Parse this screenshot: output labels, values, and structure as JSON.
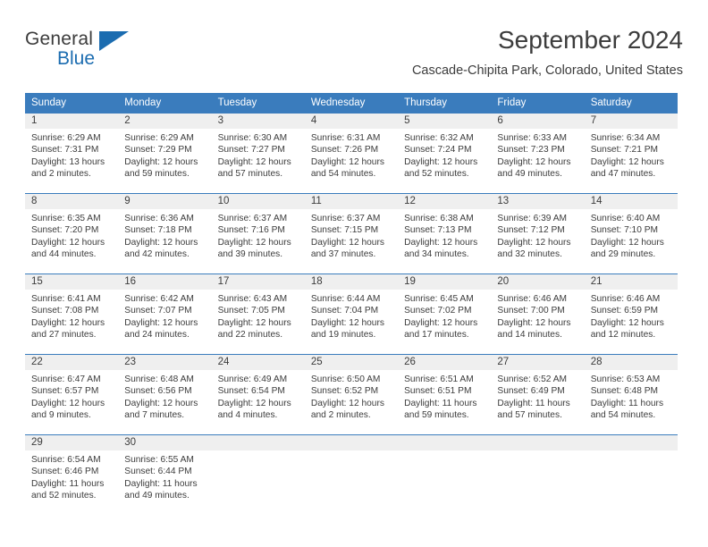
{
  "brand": {
    "name_part1": "General",
    "name_part2": "Blue",
    "flag_icon": "triangle-flag-icon",
    "color_blue": "#1b6cb0",
    "color_dark": "#3c3c3c"
  },
  "header": {
    "month_title": "September 2024",
    "location": "Cascade-Chipita Park, Colorado, United States"
  },
  "theme": {
    "header_blue": "#3a7cbd",
    "daynum_band": "#efefef",
    "text": "#3c3c3c"
  },
  "weekday_headers": [
    "Sunday",
    "Monday",
    "Tuesday",
    "Wednesday",
    "Thursday",
    "Friday",
    "Saturday"
  ],
  "labels": {
    "sunrise_prefix": "Sunrise:",
    "sunset_prefix": "Sunset:",
    "daylight_prefix": "Daylight:"
  },
  "weeks": [
    [
      {
        "day": "1",
        "sunrise": "Sunrise: 6:29 AM",
        "sunset": "Sunset: 7:31 PM",
        "daylight_line1": "Daylight: 13 hours",
        "daylight_line2": "and 2 minutes."
      },
      {
        "day": "2",
        "sunrise": "Sunrise: 6:29 AM",
        "sunset": "Sunset: 7:29 PM",
        "daylight_line1": "Daylight: 12 hours",
        "daylight_line2": "and 59 minutes."
      },
      {
        "day": "3",
        "sunrise": "Sunrise: 6:30 AM",
        "sunset": "Sunset: 7:27 PM",
        "daylight_line1": "Daylight: 12 hours",
        "daylight_line2": "and 57 minutes."
      },
      {
        "day": "4",
        "sunrise": "Sunrise: 6:31 AM",
        "sunset": "Sunset: 7:26 PM",
        "daylight_line1": "Daylight: 12 hours",
        "daylight_line2": "and 54 minutes."
      },
      {
        "day": "5",
        "sunrise": "Sunrise: 6:32 AM",
        "sunset": "Sunset: 7:24 PM",
        "daylight_line1": "Daylight: 12 hours",
        "daylight_line2": "and 52 minutes."
      },
      {
        "day": "6",
        "sunrise": "Sunrise: 6:33 AM",
        "sunset": "Sunset: 7:23 PM",
        "daylight_line1": "Daylight: 12 hours",
        "daylight_line2": "and 49 minutes."
      },
      {
        "day": "7",
        "sunrise": "Sunrise: 6:34 AM",
        "sunset": "Sunset: 7:21 PM",
        "daylight_line1": "Daylight: 12 hours",
        "daylight_line2": "and 47 minutes."
      }
    ],
    [
      {
        "day": "8",
        "sunrise": "Sunrise: 6:35 AM",
        "sunset": "Sunset: 7:20 PM",
        "daylight_line1": "Daylight: 12 hours",
        "daylight_line2": "and 44 minutes."
      },
      {
        "day": "9",
        "sunrise": "Sunrise: 6:36 AM",
        "sunset": "Sunset: 7:18 PM",
        "daylight_line1": "Daylight: 12 hours",
        "daylight_line2": "and 42 minutes."
      },
      {
        "day": "10",
        "sunrise": "Sunrise: 6:37 AM",
        "sunset": "Sunset: 7:16 PM",
        "daylight_line1": "Daylight: 12 hours",
        "daylight_line2": "and 39 minutes."
      },
      {
        "day": "11",
        "sunrise": "Sunrise: 6:37 AM",
        "sunset": "Sunset: 7:15 PM",
        "daylight_line1": "Daylight: 12 hours",
        "daylight_line2": "and 37 minutes."
      },
      {
        "day": "12",
        "sunrise": "Sunrise: 6:38 AM",
        "sunset": "Sunset: 7:13 PM",
        "daylight_line1": "Daylight: 12 hours",
        "daylight_line2": "and 34 minutes."
      },
      {
        "day": "13",
        "sunrise": "Sunrise: 6:39 AM",
        "sunset": "Sunset: 7:12 PM",
        "daylight_line1": "Daylight: 12 hours",
        "daylight_line2": "and 32 minutes."
      },
      {
        "day": "14",
        "sunrise": "Sunrise: 6:40 AM",
        "sunset": "Sunset: 7:10 PM",
        "daylight_line1": "Daylight: 12 hours",
        "daylight_line2": "and 29 minutes."
      }
    ],
    [
      {
        "day": "15",
        "sunrise": "Sunrise: 6:41 AM",
        "sunset": "Sunset: 7:08 PM",
        "daylight_line1": "Daylight: 12 hours",
        "daylight_line2": "and 27 minutes."
      },
      {
        "day": "16",
        "sunrise": "Sunrise: 6:42 AM",
        "sunset": "Sunset: 7:07 PM",
        "daylight_line1": "Daylight: 12 hours",
        "daylight_line2": "and 24 minutes."
      },
      {
        "day": "17",
        "sunrise": "Sunrise: 6:43 AM",
        "sunset": "Sunset: 7:05 PM",
        "daylight_line1": "Daylight: 12 hours",
        "daylight_line2": "and 22 minutes."
      },
      {
        "day": "18",
        "sunrise": "Sunrise: 6:44 AM",
        "sunset": "Sunset: 7:04 PM",
        "daylight_line1": "Daylight: 12 hours",
        "daylight_line2": "and 19 minutes."
      },
      {
        "day": "19",
        "sunrise": "Sunrise: 6:45 AM",
        "sunset": "Sunset: 7:02 PM",
        "daylight_line1": "Daylight: 12 hours",
        "daylight_line2": "and 17 minutes."
      },
      {
        "day": "20",
        "sunrise": "Sunrise: 6:46 AM",
        "sunset": "Sunset: 7:00 PM",
        "daylight_line1": "Daylight: 12 hours",
        "daylight_line2": "and 14 minutes."
      },
      {
        "day": "21",
        "sunrise": "Sunrise: 6:46 AM",
        "sunset": "Sunset: 6:59 PM",
        "daylight_line1": "Daylight: 12 hours",
        "daylight_line2": "and 12 minutes."
      }
    ],
    [
      {
        "day": "22",
        "sunrise": "Sunrise: 6:47 AM",
        "sunset": "Sunset: 6:57 PM",
        "daylight_line1": "Daylight: 12 hours",
        "daylight_line2": "and 9 minutes."
      },
      {
        "day": "23",
        "sunrise": "Sunrise: 6:48 AM",
        "sunset": "Sunset: 6:56 PM",
        "daylight_line1": "Daylight: 12 hours",
        "daylight_line2": "and 7 minutes."
      },
      {
        "day": "24",
        "sunrise": "Sunrise: 6:49 AM",
        "sunset": "Sunset: 6:54 PM",
        "daylight_line1": "Daylight: 12 hours",
        "daylight_line2": "and 4 minutes."
      },
      {
        "day": "25",
        "sunrise": "Sunrise: 6:50 AM",
        "sunset": "Sunset: 6:52 PM",
        "daylight_line1": "Daylight: 12 hours",
        "daylight_line2": "and 2 minutes."
      },
      {
        "day": "26",
        "sunrise": "Sunrise: 6:51 AM",
        "sunset": "Sunset: 6:51 PM",
        "daylight_line1": "Daylight: 11 hours",
        "daylight_line2": "and 59 minutes."
      },
      {
        "day": "27",
        "sunrise": "Sunrise: 6:52 AM",
        "sunset": "Sunset: 6:49 PM",
        "daylight_line1": "Daylight: 11 hours",
        "daylight_line2": "and 57 minutes."
      },
      {
        "day": "28",
        "sunrise": "Sunrise: 6:53 AM",
        "sunset": "Sunset: 6:48 PM",
        "daylight_line1": "Daylight: 11 hours",
        "daylight_line2": "and 54 minutes."
      }
    ],
    [
      {
        "day": "29",
        "sunrise": "Sunrise: 6:54 AM",
        "sunset": "Sunset: 6:46 PM",
        "daylight_line1": "Daylight: 11 hours",
        "daylight_line2": "and 52 minutes."
      },
      {
        "day": "30",
        "sunrise": "Sunrise: 6:55 AM",
        "sunset": "Sunset: 6:44 PM",
        "daylight_line1": "Daylight: 11 hours",
        "daylight_line2": "and 49 minutes."
      },
      {
        "day": "",
        "sunrise": "",
        "sunset": "",
        "daylight_line1": "",
        "daylight_line2": ""
      },
      {
        "day": "",
        "sunrise": "",
        "sunset": "",
        "daylight_line1": "",
        "daylight_line2": ""
      },
      {
        "day": "",
        "sunrise": "",
        "sunset": "",
        "daylight_line1": "",
        "daylight_line2": ""
      },
      {
        "day": "",
        "sunrise": "",
        "sunset": "",
        "daylight_line1": "",
        "daylight_line2": ""
      },
      {
        "day": "",
        "sunrise": "",
        "sunset": "",
        "daylight_line1": "",
        "daylight_line2": ""
      }
    ]
  ]
}
